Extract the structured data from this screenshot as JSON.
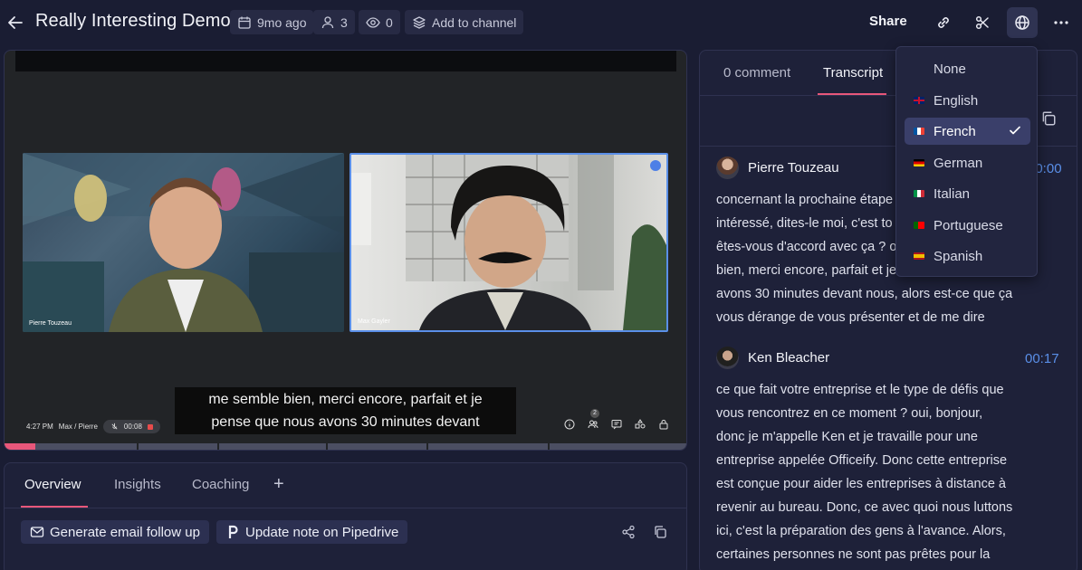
{
  "header": {
    "title": "Really Interesting Demo",
    "date_chip": "9mo ago",
    "participants_chip": "3",
    "views_chip": "0",
    "channel_chip": "Add to channel",
    "share_label": "Share"
  },
  "video": {
    "left_participant": "Pierre Touzeau",
    "right_participant": "Max Gayler",
    "caption_lines": [
      "me semble bien, merci encore, parfait et je",
      "pense que nous avons 30 minutes devant"
    ],
    "clock": "4:27 PM",
    "meeting_label": "Max / Pierre",
    "rec_time": "00:08",
    "participants_badge": "2",
    "progress_percent": 4.5
  },
  "overview": {
    "tabs": [
      "Overview",
      "Insights",
      "Coaching"
    ],
    "plus": "+",
    "generate_email": "Generate email follow up",
    "update_note": "Update note on Pipedrive"
  },
  "transcript": {
    "tabs": [
      "0 comment",
      "Transcript"
    ],
    "entries": [
      {
        "speaker": "Pierre Touzeau",
        "time": "00:00",
        "lines": [
          "concernant la prochaine étape",
          "intéressé, dites-le moi, c'est to",
          "êtes-vous d'accord avec ça ? o",
          "bien, merci encore, parfait et je",
          "avons 30 minutes devant nous, alors est-ce que ça",
          "vous dérange de vous présenter et de me dire"
        ]
      },
      {
        "speaker": "Ken Bleacher",
        "time": "00:17",
        "lines": [
          "ce que fait votre entreprise et le type de défis que",
          "vous rencontrez en ce moment ? oui, bonjour,",
          "donc je m'appelle Ken et je travaille pour une",
          "entreprise appelée Officeify. Donc cette entreprise",
          "est conçue pour aider les entreprises à distance à",
          "revenir au bureau. Donc, ce avec quoi nous luttons",
          "ici, c'est la préparation des gens à l'avance. Alors,",
          "certaines personnes ne sont pas prêtes pour la"
        ]
      }
    ]
  },
  "language_menu": {
    "options": [
      "None",
      "English",
      "French",
      "German",
      "Italian",
      "Portuguese",
      "Spanish"
    ],
    "selected": "French"
  }
}
